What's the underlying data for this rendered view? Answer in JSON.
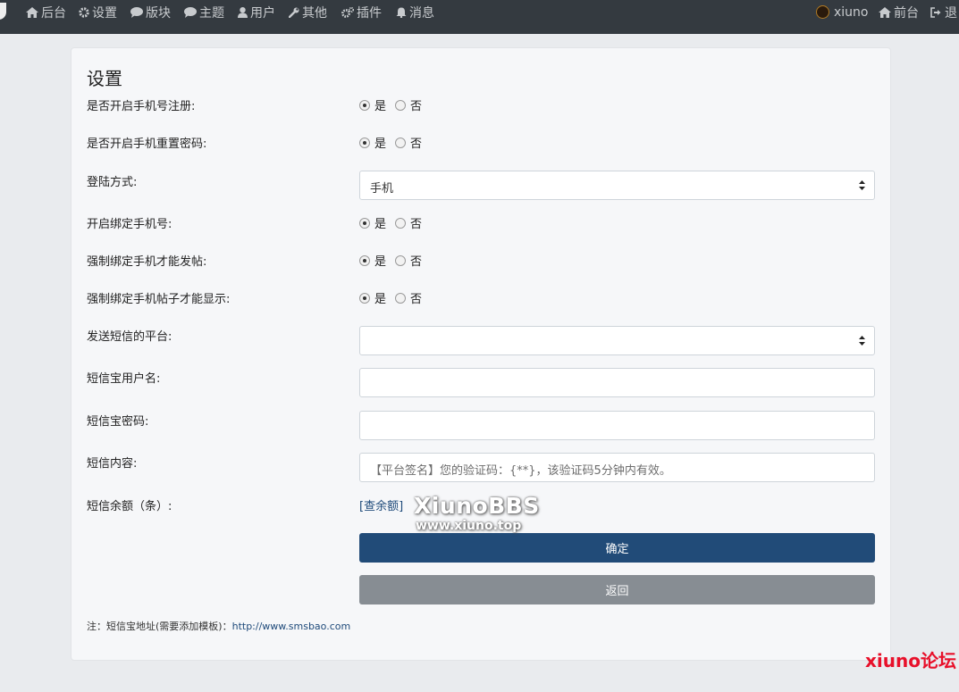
{
  "nav": {
    "left": [
      {
        "label": "后台",
        "icon": "home-icon"
      },
      {
        "label": "设置",
        "icon": "gear-icon"
      },
      {
        "label": "版块",
        "icon": "comment-icon"
      },
      {
        "label": "主题",
        "icon": "comment-icon"
      },
      {
        "label": "用户",
        "icon": "user-icon"
      },
      {
        "label": "其他",
        "icon": "wrench-icon"
      },
      {
        "label": "插件",
        "icon": "gears-icon"
      },
      {
        "label": "消息",
        "icon": "bell-icon"
      }
    ],
    "right": [
      {
        "label": "xiuno",
        "icon": "avatar"
      },
      {
        "label": "前台",
        "icon": "home-icon"
      },
      {
        "label": "退",
        "icon": "sign-out-icon"
      }
    ]
  },
  "card": {
    "title": "设置",
    "radio_options": {
      "yes": "是",
      "no": "否"
    },
    "fields": {
      "phone_register": {
        "label": "是否开启手机号注册:",
        "value": "是"
      },
      "phone_reset": {
        "label": "是否开启手机重置密码:",
        "value": "是"
      },
      "login_method": {
        "label": "登陆方式:",
        "selected": "手机"
      },
      "bind_phone": {
        "label": "开启绑定手机号:",
        "value": "是"
      },
      "force_bind_post": {
        "label": "强制绑定手机才能发帖:",
        "value": "是"
      },
      "force_bind_show": {
        "label": "强制绑定手机帖子才能显示:",
        "value": "是"
      },
      "sms_platform": {
        "label": "发送短信的平台:",
        "selected": ""
      },
      "sms_username": {
        "label": "短信宝用户名:",
        "value": ""
      },
      "sms_password": {
        "label": "短信宝密码:",
        "value": ""
      },
      "sms_content": {
        "label": "短信内容:",
        "placeholder": "【平台签名】您的验证码：{**}，该验证码5分钟内有效。"
      },
      "sms_balance": {
        "label": "短信余额（条）:",
        "link": "[查余额]"
      }
    },
    "submit_label": "确定",
    "back_label": "返回",
    "footnote": {
      "prefix": "注：短信宝地址(需要添加模板)：",
      "url": "http://www.smsbao.com"
    }
  },
  "watermark": {
    "line1": "XiunoBBS",
    "line2": "www.xiuno.top"
  },
  "corner_mark": "xiuno论坛"
}
